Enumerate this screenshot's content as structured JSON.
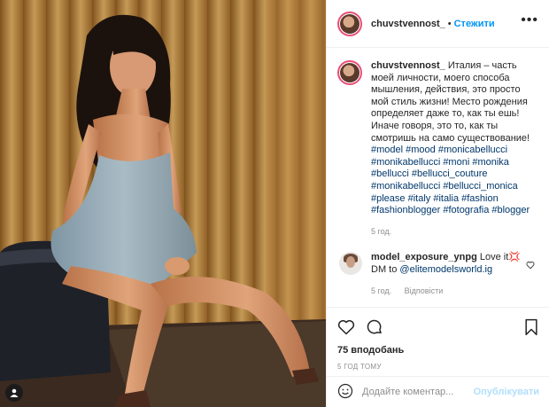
{
  "post": {
    "username": "chuvstvennost_",
    "separator": "•",
    "follow_label": "Стежити",
    "more_label": "•••",
    "caption_username": "chuvstvennost_",
    "caption_text": "Италия – часть моей личности, моего способа мышления, действия, это просто мой стиль жизни! Место рождения определяет даже то, как ты ешь! Иначе говоря, это то, как ты смотришь на само существование!",
    "hashtags": "#model #mood #monicabellucci #monikabellucci #moni #monika #bellucci #bellucci_couture #monikabellucci #bellucci_monica #please #italy #italia #fashion #fashionblogger #fotografia #blogger",
    "caption_age": "5 год."
  },
  "comment": {
    "username": "model_exposure_ynpg",
    "text_before": "Love it",
    "emoji": "💢",
    "text_dm": "DM to",
    "mention": "@elitemodelsworld.ig",
    "age": "5 год.",
    "reply_label": "Відповісти"
  },
  "stats": {
    "likes": "75 вподобань",
    "timestamp": "5 ГОД ТОМУ"
  },
  "add_comment": {
    "placeholder": "Додайте коментар...",
    "post_label": "Опублікувати"
  },
  "icons": [
    "user-tag-icon",
    "heart-icon",
    "comment-icon",
    "share-icon",
    "bookmark-icon",
    "emoji-icon"
  ]
}
